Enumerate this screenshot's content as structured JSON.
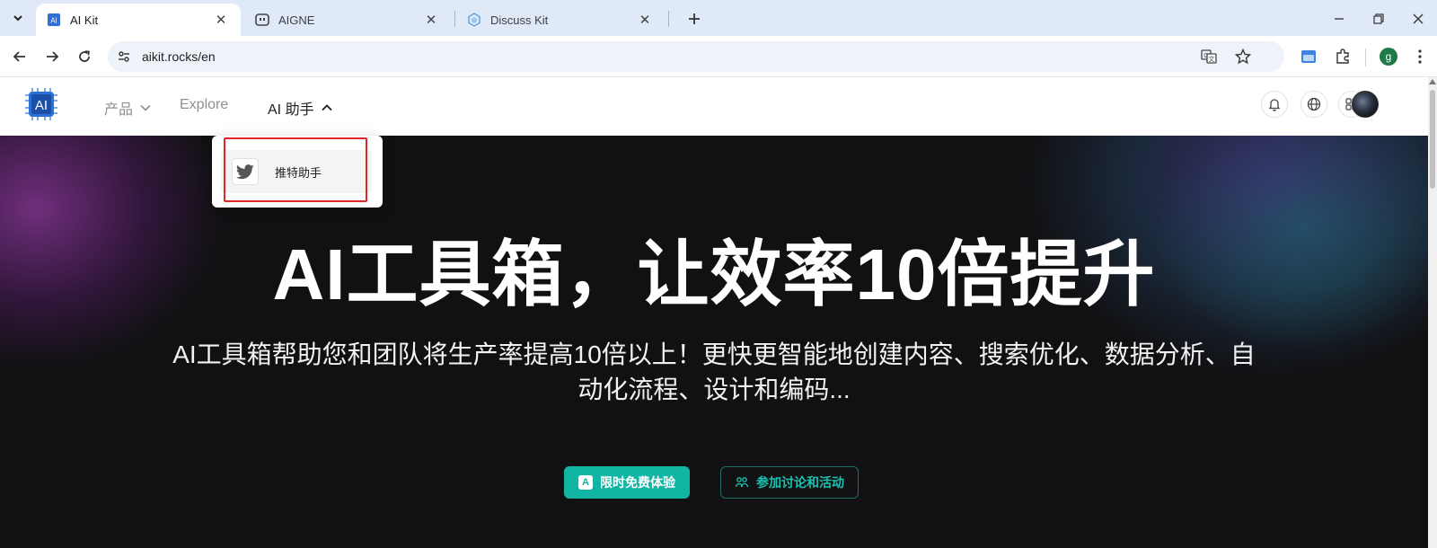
{
  "browser": {
    "tabs": [
      {
        "title": "AI Kit",
        "active": true,
        "favicon": "aikit-favicon"
      },
      {
        "title": "AIGNE",
        "active": false,
        "favicon": "aigne-favicon"
      },
      {
        "title": "Discuss Kit",
        "active": false,
        "favicon": "discuss-kit-favicon"
      }
    ],
    "url": "aikit.rocks/en",
    "profile_initial": "g"
  },
  "site": {
    "logo_text": "AI",
    "nav": {
      "products": "产品",
      "explore": "Explore",
      "ai_assistant": "AI 助手"
    },
    "dropdown": {
      "items": [
        {
          "label": "推特助手",
          "icon": "twitter-icon"
        }
      ]
    },
    "hero": {
      "title": "AI工具箱，让效率10倍提升",
      "subtitle": "AI工具箱帮助您和团队将生产率提高10倍以上！更快更智能地创建内容、搜索优化、数据分析、自动化流程、设计和编码...",
      "primary_button": "限时免费体验",
      "secondary_button": "参加讨论和活动"
    }
  },
  "colors": {
    "accent": "#12b5a4",
    "hero_bg": "#111113",
    "highlight": "#e3262a"
  }
}
